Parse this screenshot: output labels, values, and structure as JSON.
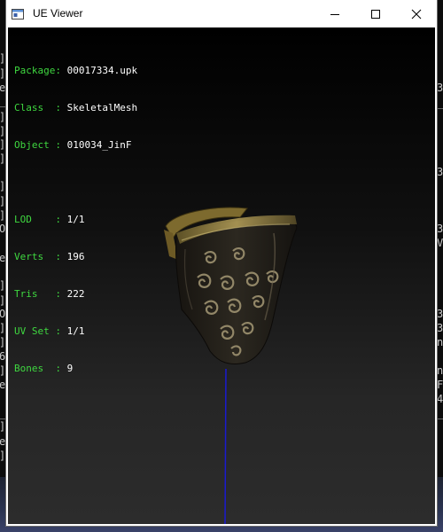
{
  "window": {
    "title": "UE Viewer",
    "buttons": {
      "minimize": "minimize-icon",
      "maximize": "maximize-icon",
      "close": "close-icon"
    }
  },
  "info": {
    "package": {
      "label": "Package:",
      "value": "00017334.upk"
    },
    "class": {
      "label": "Class  :",
      "value": "SkeletalMesh"
    },
    "object": {
      "label": "Object :",
      "value": "010034_JinF"
    },
    "lod": {
      "label": "LOD    :",
      "value": "1/1"
    },
    "verts": {
      "label": "Verts  :",
      "value": "196"
    },
    "tris": {
      "label": "Tris   :",
      "value": "222"
    },
    "uvset": {
      "label": "UV Set :",
      "value": "1/1"
    },
    "bones": {
      "label": "Bones  :",
      "value": "9"
    }
  },
  "colors": {
    "label": "#3fd840",
    "value": "#ffffff",
    "axis": "#1a1ad0",
    "mesh_dark": "#1e1b16",
    "mesh_gold": "#8a7a45"
  },
  "background_console": {
    "left": [
      "]",
      "]",
      "e",
      "_",
      "]",
      "]",
      "]",
      "]",
      "]",
      "]",
      "]",
      "O",
      "e",
      "]",
      "]",
      "O",
      "]",
      "]",
      "6",
      "]",
      "e",
      "_",
      "]",
      "e",
      "]"
    ],
    "right": [
      "3",
      "_",
      "3",
      "3",
      "V",
      "3",
      "3",
      "n",
      "n",
      "F",
      "4",
      "_"
    ]
  }
}
